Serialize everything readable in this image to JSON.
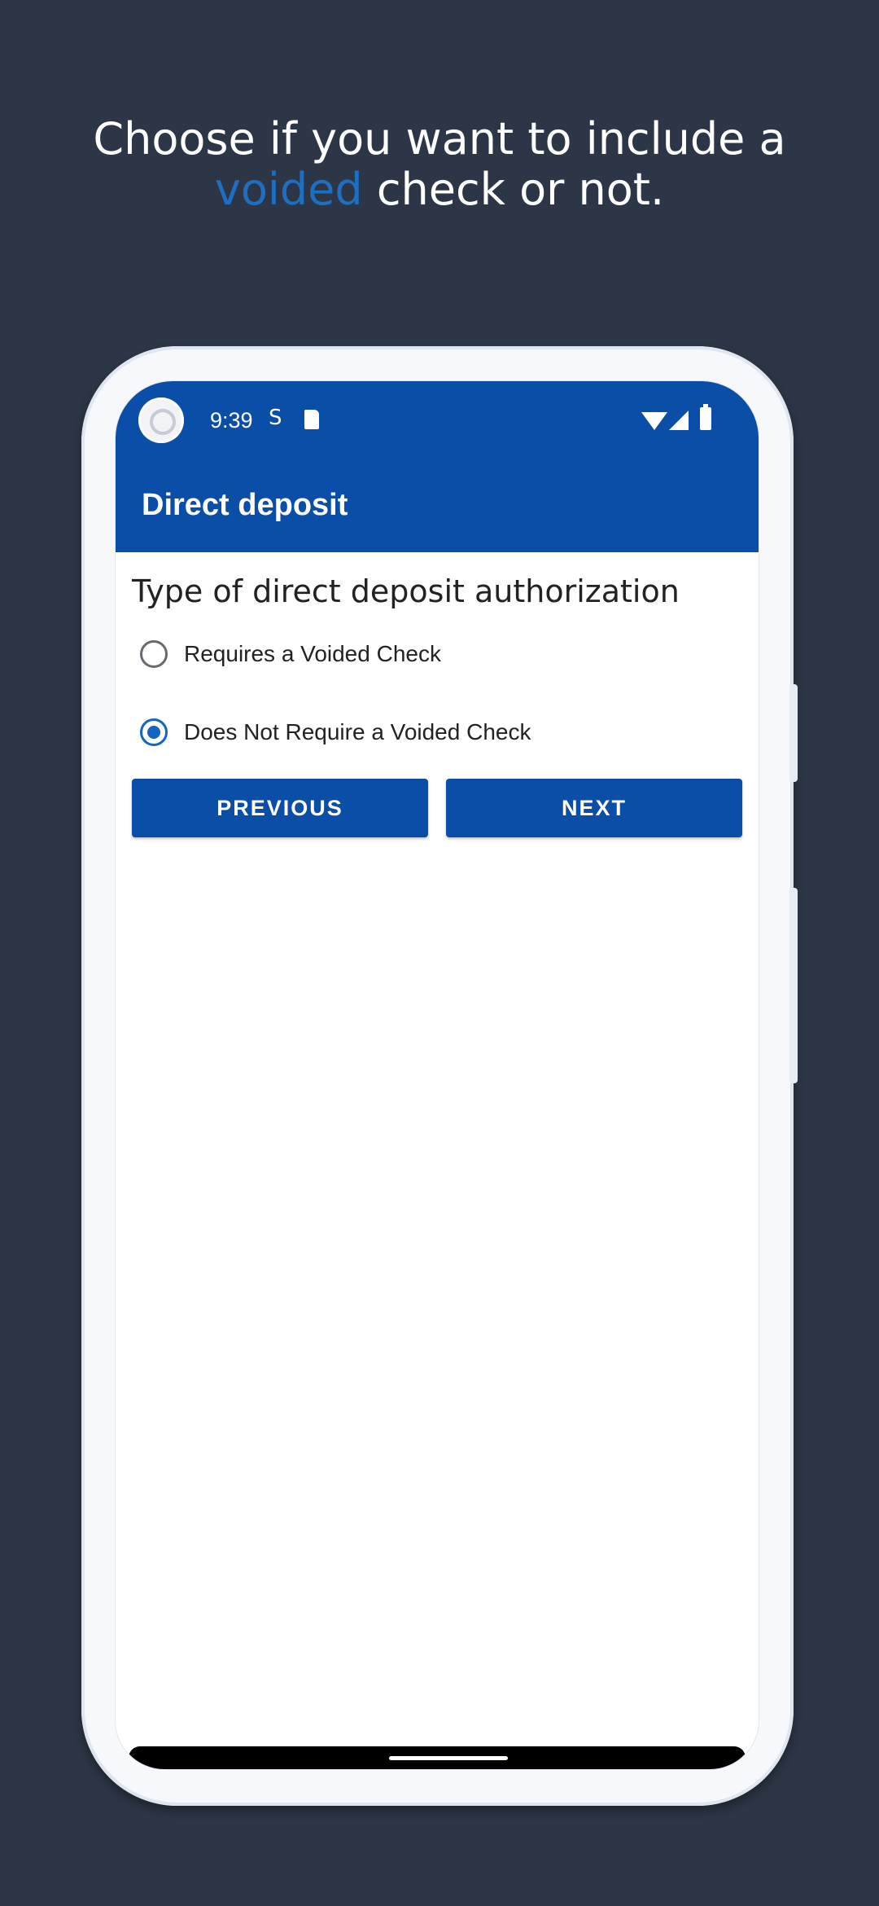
{
  "caption": {
    "line1": "Choose if you want to include a",
    "accent_word": "voided",
    "line2_rest": " check or not."
  },
  "status_bar": {
    "time": "9:39",
    "icons": [
      "app-avatar-icon",
      "s-notification-icon",
      "sd-card-icon",
      "wifi-icon",
      "signal-icon",
      "battery-icon"
    ]
  },
  "app_bar": {
    "title": "Direct deposit"
  },
  "form": {
    "section_title": "Type of direct deposit authorization",
    "options": [
      {
        "label": "Requires a Voided Check",
        "checked": false
      },
      {
        "label": "Does Not Require a Voided Check",
        "checked": true
      }
    ]
  },
  "buttons": {
    "previous": "PREVIOUS",
    "next": "NEXT"
  },
  "colors": {
    "background": "#2d3646",
    "brand": "#0b4ea7",
    "accent": "#1e6fc1",
    "radio_checked": "#1565c0"
  }
}
